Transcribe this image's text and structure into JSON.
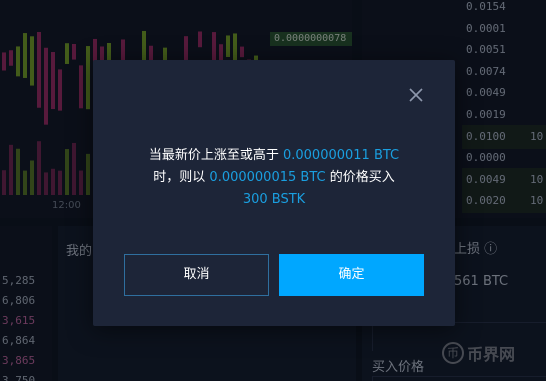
{
  "chart": {
    "last_price": "0.0000000078",
    "time_label": "12:00"
  },
  "orderbook": {
    "rows": [
      {
        "value": "0.0154",
        "tail": ""
      },
      {
        "value": "0.0001",
        "tail": ""
      },
      {
        "value": "0.0051",
        "tail": ""
      },
      {
        "value": "0.0074",
        "tail": ""
      },
      {
        "value": "0.0049",
        "tail": ""
      },
      {
        "value": "0.0019",
        "tail": ""
      },
      {
        "value": "0.0100",
        "tail": "10"
      },
      {
        "value": "0.0000",
        "tail": ""
      },
      {
        "value": "0.0049",
        "tail": "10"
      },
      {
        "value": "0.0020",
        "tail": "10"
      }
    ]
  },
  "bottom_left": {
    "rows": [
      {
        "value": "5,285",
        "color": "#aeb8cc"
      },
      {
        "value": "6,806",
        "color": "#aeb8cc"
      },
      {
        "value": "3,615",
        "color": "#c46aa8"
      },
      {
        "value": "6,864",
        "color": "#aeb8cc"
      },
      {
        "value": "3,865",
        "color": "#c46aa8"
      },
      {
        "value": "3,750",
        "color": "#aeb8cc"
      }
    ]
  },
  "mid_panel": {
    "title": "我的"
  },
  "right_panel": {
    "stop_label": "上损 ⓘ",
    "stop_value": "561 BTC",
    "buy_price_label": "买入价格"
  },
  "watermark": {
    "icon_char": "币",
    "text": "币界网"
  },
  "modal": {
    "line1_prefix": "当最新价上涨至或高于 ",
    "trigger_price": "0.000000011 BTC",
    "line2_prefix": "时，则以 ",
    "order_price": "0.000000015 BTC",
    "line2_suffix": " 的价格买入",
    "quantity": "300 BSTK",
    "cancel_label": "取消",
    "confirm_label": "确定"
  },
  "colors": {
    "accent": "#00a7ff",
    "highlight_text": "#1a9fe0",
    "up": "#7ba830",
    "down": "#a0306e"
  }
}
